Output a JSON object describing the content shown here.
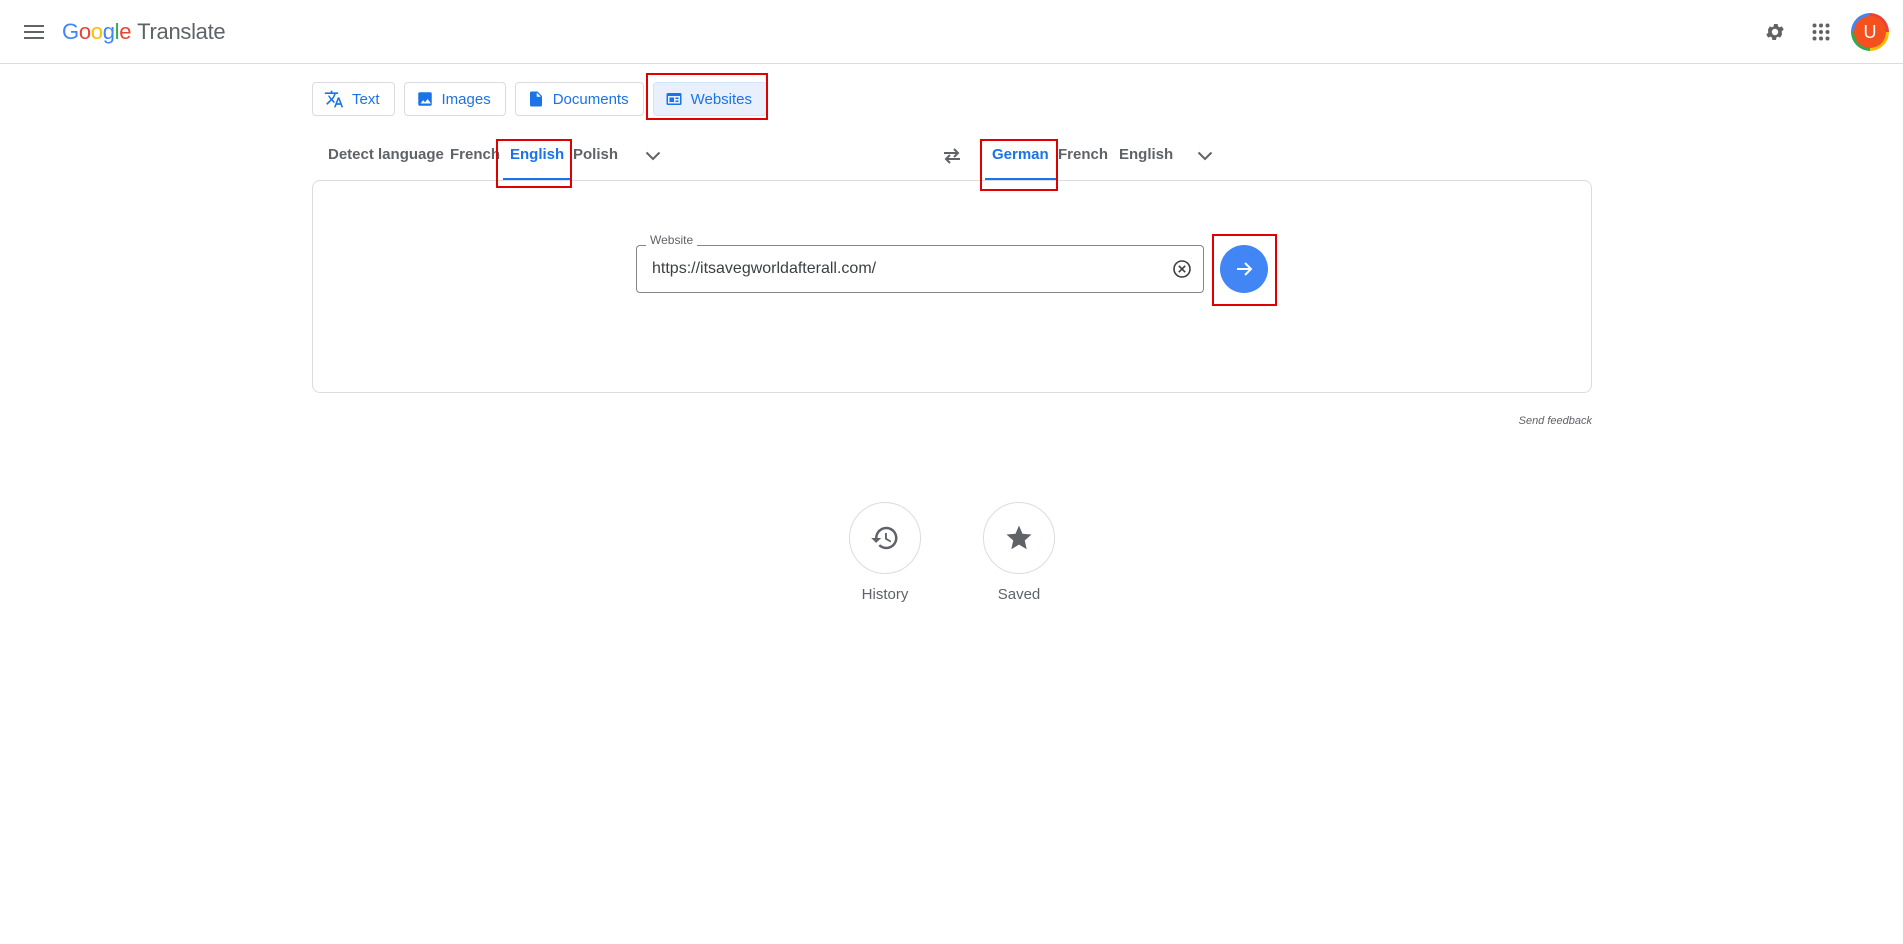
{
  "header": {
    "logo_letters": [
      "G",
      "o",
      "o",
      "g",
      "l",
      "e"
    ],
    "product": "Translate",
    "avatar_initial": "U"
  },
  "modes": [
    {
      "label": "Text",
      "icon": "translate-icon"
    },
    {
      "label": "Images",
      "icon": "image-icon"
    },
    {
      "label": "Documents",
      "icon": "document-icon"
    },
    {
      "label": "Websites",
      "icon": "website-icon",
      "active": true
    }
  ],
  "source_langs": [
    "Detect language",
    "French",
    "English",
    "Polish"
  ],
  "source_active": "English",
  "target_langs": [
    "German",
    "French",
    "English"
  ],
  "target_active": "German",
  "website": {
    "legend": "Website",
    "value": "https://itsavegworldafterall.com/"
  },
  "feedback": "Send feedback",
  "bottom": {
    "history": "History",
    "saved": "Saved"
  },
  "colors": {
    "accent": "#1a73e8",
    "go_button": "#4285f4",
    "highlight": "#e00000",
    "avatar": "#f4511e"
  }
}
